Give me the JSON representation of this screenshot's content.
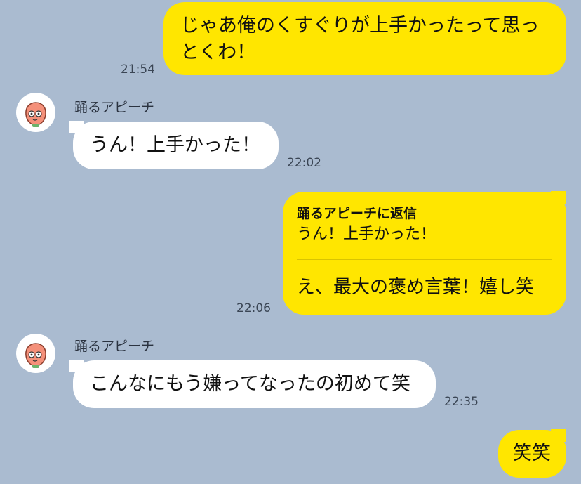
{
  "chat": {
    "messages": [
      {
        "side": "out",
        "text": "じゃあ俺のくすぐりが上手かったって思っとくわ！",
        "line1": "じゃあ俺のくすぐりが上手かったって思っ",
        "line2": "とくわ！",
        "time": "21:54"
      },
      {
        "side": "in",
        "sender": "踊るアピーチ",
        "text": "うん！上手かった！",
        "time": "22:02"
      },
      {
        "side": "out",
        "reply_header": "踊るアピーチに返信",
        "reply_quote": "うん！上手かった！",
        "text": "え、最大の褒め言葉！嬉し笑",
        "time": "22:06"
      },
      {
        "side": "in",
        "sender": "踊るアピーチ",
        "text": "こんなにもう嫌ってなったの初めて笑",
        "time": "22:35"
      },
      {
        "side": "out",
        "text": "笑笑"
      }
    ]
  },
  "colors": {
    "background": "#aabbd0",
    "outgoing_bubble": "#ffe600",
    "incoming_bubble": "#ffffff",
    "avatar_peach": "#f4907a"
  },
  "icons": {
    "avatar": "peach-character-avatar"
  }
}
